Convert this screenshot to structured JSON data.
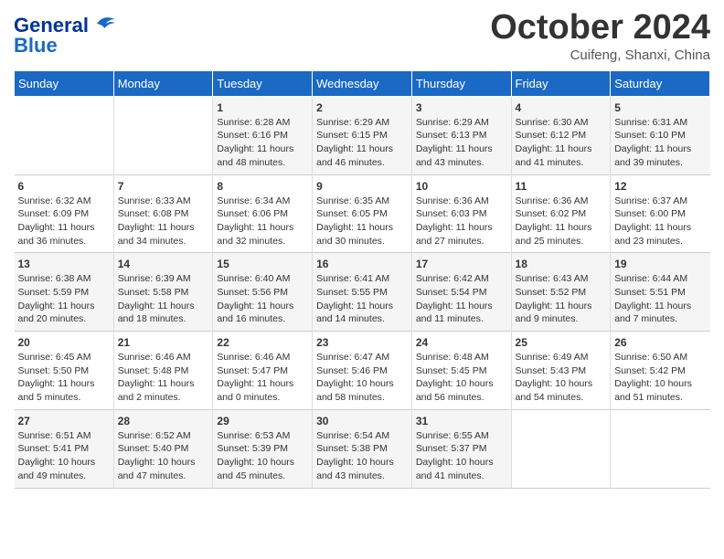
{
  "header": {
    "logo_line1": "General",
    "logo_line2": "Blue",
    "month": "October 2024",
    "location": "Cuifeng, Shanxi, China"
  },
  "weekdays": [
    "Sunday",
    "Monday",
    "Tuesday",
    "Wednesday",
    "Thursday",
    "Friday",
    "Saturday"
  ],
  "rows": [
    [
      {
        "day": "",
        "info": ""
      },
      {
        "day": "",
        "info": ""
      },
      {
        "day": "1",
        "info": "Sunrise: 6:28 AM\nSunset: 6:16 PM\nDaylight: 11 hours and 48 minutes."
      },
      {
        "day": "2",
        "info": "Sunrise: 6:29 AM\nSunset: 6:15 PM\nDaylight: 11 hours and 46 minutes."
      },
      {
        "day": "3",
        "info": "Sunrise: 6:29 AM\nSunset: 6:13 PM\nDaylight: 11 hours and 43 minutes."
      },
      {
        "day": "4",
        "info": "Sunrise: 6:30 AM\nSunset: 6:12 PM\nDaylight: 11 hours and 41 minutes."
      },
      {
        "day": "5",
        "info": "Sunrise: 6:31 AM\nSunset: 6:10 PM\nDaylight: 11 hours and 39 minutes."
      }
    ],
    [
      {
        "day": "6",
        "info": "Sunrise: 6:32 AM\nSunset: 6:09 PM\nDaylight: 11 hours and 36 minutes."
      },
      {
        "day": "7",
        "info": "Sunrise: 6:33 AM\nSunset: 6:08 PM\nDaylight: 11 hours and 34 minutes."
      },
      {
        "day": "8",
        "info": "Sunrise: 6:34 AM\nSunset: 6:06 PM\nDaylight: 11 hours and 32 minutes."
      },
      {
        "day": "9",
        "info": "Sunrise: 6:35 AM\nSunset: 6:05 PM\nDaylight: 11 hours and 30 minutes."
      },
      {
        "day": "10",
        "info": "Sunrise: 6:36 AM\nSunset: 6:03 PM\nDaylight: 11 hours and 27 minutes."
      },
      {
        "day": "11",
        "info": "Sunrise: 6:36 AM\nSunset: 6:02 PM\nDaylight: 11 hours and 25 minutes."
      },
      {
        "day": "12",
        "info": "Sunrise: 6:37 AM\nSunset: 6:00 PM\nDaylight: 11 hours and 23 minutes."
      }
    ],
    [
      {
        "day": "13",
        "info": "Sunrise: 6:38 AM\nSunset: 5:59 PM\nDaylight: 11 hours and 20 minutes."
      },
      {
        "day": "14",
        "info": "Sunrise: 6:39 AM\nSunset: 5:58 PM\nDaylight: 11 hours and 18 minutes."
      },
      {
        "day": "15",
        "info": "Sunrise: 6:40 AM\nSunset: 5:56 PM\nDaylight: 11 hours and 16 minutes."
      },
      {
        "day": "16",
        "info": "Sunrise: 6:41 AM\nSunset: 5:55 PM\nDaylight: 11 hours and 14 minutes."
      },
      {
        "day": "17",
        "info": "Sunrise: 6:42 AM\nSunset: 5:54 PM\nDaylight: 11 hours and 11 minutes."
      },
      {
        "day": "18",
        "info": "Sunrise: 6:43 AM\nSunset: 5:52 PM\nDaylight: 11 hours and 9 minutes."
      },
      {
        "day": "19",
        "info": "Sunrise: 6:44 AM\nSunset: 5:51 PM\nDaylight: 11 hours and 7 minutes."
      }
    ],
    [
      {
        "day": "20",
        "info": "Sunrise: 6:45 AM\nSunset: 5:50 PM\nDaylight: 11 hours and 5 minutes."
      },
      {
        "day": "21",
        "info": "Sunrise: 6:46 AM\nSunset: 5:48 PM\nDaylight: 11 hours and 2 minutes."
      },
      {
        "day": "22",
        "info": "Sunrise: 6:46 AM\nSunset: 5:47 PM\nDaylight: 11 hours and 0 minutes."
      },
      {
        "day": "23",
        "info": "Sunrise: 6:47 AM\nSunset: 5:46 PM\nDaylight: 10 hours and 58 minutes."
      },
      {
        "day": "24",
        "info": "Sunrise: 6:48 AM\nSunset: 5:45 PM\nDaylight: 10 hours and 56 minutes."
      },
      {
        "day": "25",
        "info": "Sunrise: 6:49 AM\nSunset: 5:43 PM\nDaylight: 10 hours and 54 minutes."
      },
      {
        "day": "26",
        "info": "Sunrise: 6:50 AM\nSunset: 5:42 PM\nDaylight: 10 hours and 51 minutes."
      }
    ],
    [
      {
        "day": "27",
        "info": "Sunrise: 6:51 AM\nSunset: 5:41 PM\nDaylight: 10 hours and 49 minutes."
      },
      {
        "day": "28",
        "info": "Sunrise: 6:52 AM\nSunset: 5:40 PM\nDaylight: 10 hours and 47 minutes."
      },
      {
        "day": "29",
        "info": "Sunrise: 6:53 AM\nSunset: 5:39 PM\nDaylight: 10 hours and 45 minutes."
      },
      {
        "day": "30",
        "info": "Sunrise: 6:54 AM\nSunset: 5:38 PM\nDaylight: 10 hours and 43 minutes."
      },
      {
        "day": "31",
        "info": "Sunrise: 6:55 AM\nSunset: 5:37 PM\nDaylight: 10 hours and 41 minutes."
      },
      {
        "day": "",
        "info": ""
      },
      {
        "day": "",
        "info": ""
      }
    ]
  ]
}
